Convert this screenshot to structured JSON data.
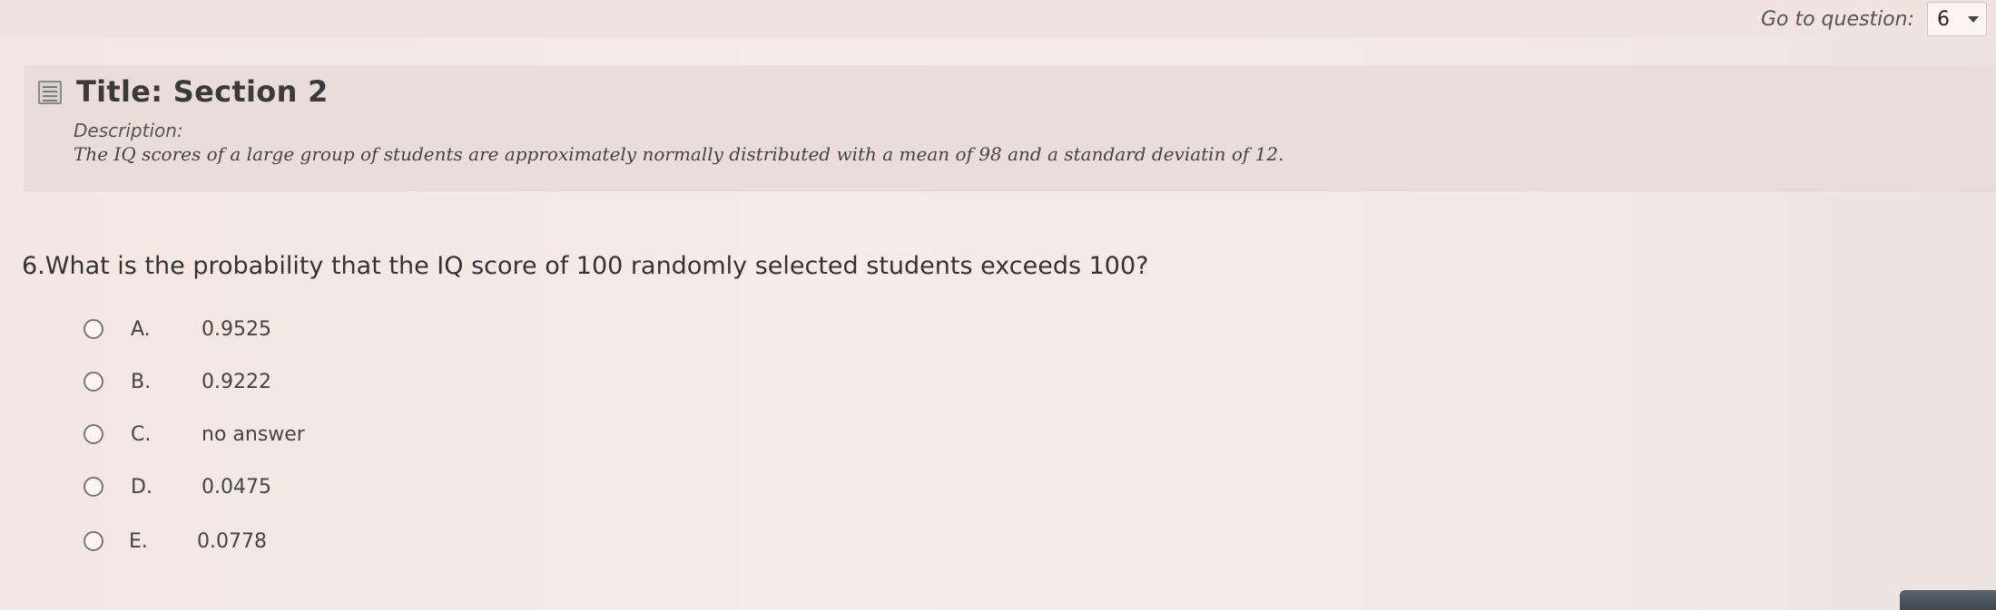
{
  "header": {
    "goto_label": "Go to question:",
    "goto_value": "6"
  },
  "section": {
    "title": "Title: Section 2",
    "description_label": "Description:",
    "description": "The IQ scores of a large group of students are approximately normally distributed with a mean of 98 and a standard deviatin of 12."
  },
  "question": {
    "text": "6.What is the probability that the IQ score of 100 randomly selected students exceeds 100?",
    "options": [
      {
        "letter": "A.",
        "text": "0.9525"
      },
      {
        "letter": "B.",
        "text": "0.9222"
      },
      {
        "letter": "C.",
        "text": "no answer"
      },
      {
        "letter": "D.",
        "text": "0.0475"
      },
      {
        "letter": "E.",
        "text": "0.0778"
      }
    ]
  }
}
